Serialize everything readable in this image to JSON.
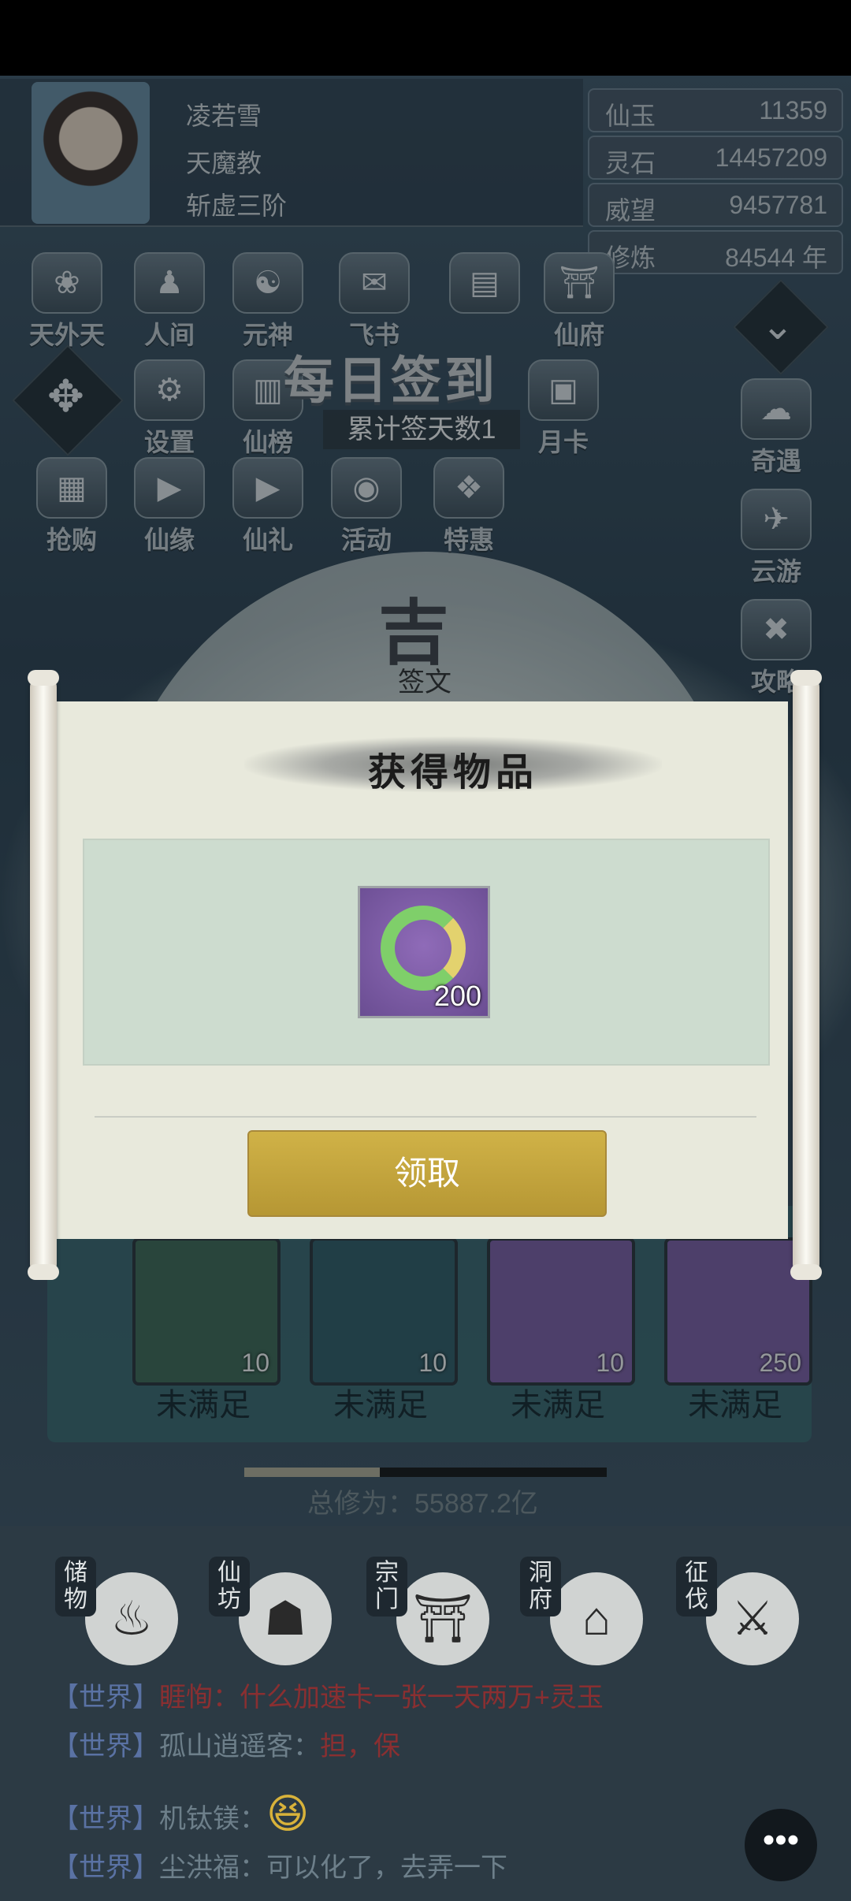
{
  "player": {
    "name": "凌若雪",
    "sect": "天魔教",
    "realm": "斩虚三阶"
  },
  "resources": [
    {
      "label": "仙玉",
      "value": "11359"
    },
    {
      "label": "灵石",
      "value": "14457209"
    },
    {
      "label": "威望",
      "value": "9457781"
    },
    {
      "label": "修炼",
      "value": "84544 年"
    }
  ],
  "menu_row1": [
    "天外天",
    "人间",
    "元神",
    "飞书",
    "",
    "仙府"
  ],
  "menu_row2": [
    "设置",
    "仙榜",
    "",
    "月卡"
  ],
  "menu_row3": [
    "抢购",
    "仙缘",
    "仙礼",
    "活动",
    "特惠"
  ],
  "right_menu": [
    "奇遇",
    "云游",
    "攻略"
  ],
  "signin": {
    "title": "每日签到",
    "subtitle": "累计签天数1",
    "fortune": "吉",
    "fortune_label": "签文"
  },
  "modal": {
    "title": "获得物品",
    "item_count": "200",
    "claim_label": "领取"
  },
  "rewards": [
    {
      "qty": "10",
      "status": "未满足"
    },
    {
      "qty": "10",
      "status": "未满足"
    },
    {
      "qty": "10",
      "status": "未满足"
    },
    {
      "qty": "250",
      "status": "未满足"
    }
  ],
  "total_cultivation": "总修为：55887.2亿",
  "bottom_nav": [
    "储物",
    "仙坊",
    "宗门",
    "洞府",
    "征伐"
  ],
  "chat": [
    {
      "channel": "【世界】",
      "name": "睚恂：",
      "msg": "什么加速卡一张一天两万+灵玉"
    },
    {
      "channel": "【世界】",
      "name": "孤山逍遥客：",
      "msg": "担，保"
    },
    {
      "channel": "【世界】",
      "name": "机钛镁：",
      "msg": "😆"
    },
    {
      "channel": "【世界】",
      "name": "尘洪福：",
      "msg": "可以化了，去弄一下"
    }
  ],
  "colors": {
    "claim_button": "#c4a63e",
    "item_bg": "#7f5ea8",
    "chat_channel": "#5a72a4",
    "chat_alert": "#8a2f31"
  }
}
